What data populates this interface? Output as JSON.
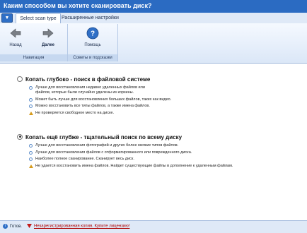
{
  "window": {
    "title": "Каким способом вы хотите сканировать диск?"
  },
  "ribbon": {
    "app_button": "▼",
    "tabs": [
      {
        "label": "Select scan type",
        "active": true
      },
      {
        "label": "Расширенные настройки",
        "active": false
      }
    ],
    "groups": [
      {
        "label": "Навигация",
        "buttons": [
          {
            "label": "Назад",
            "icon": "arrow-left-icon"
          },
          {
            "label": "Далее",
            "icon": "arrow-right-icon"
          }
        ]
      },
      {
        "label": "Советы и подсказки",
        "buttons": [
          {
            "label": "Помощь",
            "icon": "help-icon"
          }
        ]
      }
    ]
  },
  "options": [
    {
      "title": "Копать глубоко - поиск в файловой системе",
      "selected": false,
      "bullets": [
        {
          "text": "Лучше для восстановления недавно удаленных файлов или файлов, которые были случайно удалены из корзины.",
          "icon": "info-icon"
        },
        {
          "text": "Может быть лучше для восстановления больших файлов, таких как видео.",
          "icon": "info-icon"
        },
        {
          "text": "Можно восстановить все типы файлов, а также имена файлов.",
          "icon": "info-icon"
        },
        {
          "text": "Не проверяется свободное место на диске.",
          "icon": "warning-icon"
        }
      ]
    },
    {
      "title": "Копать ещё глубже - тщательный поиск по всему диску",
      "selected": true,
      "bullets": [
        {
          "text": "Лучше для восстановления фотографий и других более мелких типов файлов.",
          "icon": "info-icon"
        },
        {
          "text": "Лучше для восстановления файлов с отформатированного или поврежденного диска.",
          "icon": "info-icon"
        },
        {
          "text": "Наиболее полное сканирование. Сканирует весь диск.",
          "icon": "info-icon"
        },
        {
          "text": "Не удается восстановить имена файлов. Найдет существующие файлы в дополнение к удаленным файлам.",
          "icon": "warning-icon"
        }
      ]
    }
  ],
  "status": {
    "ready": "Готов.",
    "license": "Незарегистрированная копия. Купите лицензию!"
  },
  "colors": {
    "accent": "#2b6bc2",
    "warning": "#d69b1d",
    "link": "#b00000"
  }
}
